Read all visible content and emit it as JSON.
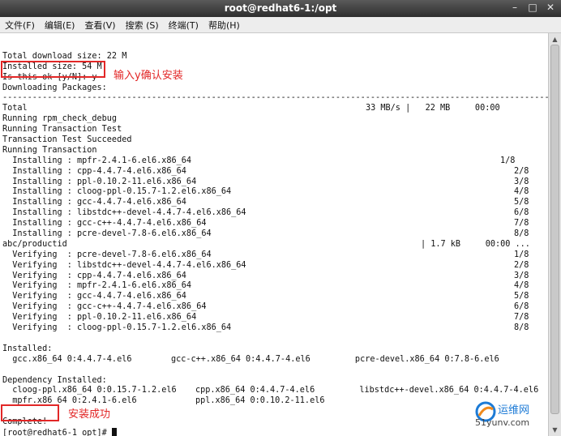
{
  "window": {
    "title": "root@redhat6-1:/opt",
    "buttons": [
      "–",
      "□",
      "✕"
    ]
  },
  "menu": [
    "文件(F)",
    "编辑(E)",
    "查看(V)",
    "搜索 (S)",
    "终端(T)",
    "帮助(H)"
  ],
  "terminal": {
    "lines": [
      {
        "t": ""
      },
      {
        "t": "Total download size: 22 M"
      },
      {
        "t": "Installed size: 54 M"
      },
      {
        "t": "Is this ok [y/N]: y"
      },
      {
        "t": "Downloading Packages:"
      },
      {
        "t": "--------------------------------------------------------------------------------------------------------------"
      },
      {
        "t": "Total",
        "c2": "33 MB/s |   22 MB     00:00",
        "c2x": 448
      },
      {
        "t": "Running rpm_check_debug"
      },
      {
        "t": "Running Transaction Test"
      },
      {
        "t": "Transaction Test Succeeded"
      },
      {
        "t": "Running Transaction"
      },
      {
        "t": "  Installing : mpfr-2.4.1-6.el6.x86_64",
        "c2": "1/8",
        "c2x": 614
      },
      {
        "t": "  Installing : cpp-4.4.7-4.el6.x86_64",
        "c2": "2/8",
        "c2x": 631
      },
      {
        "t": "  Installing : ppl-0.10.2-11.el6.x86_64",
        "c2": "3/8",
        "c2x": 631
      },
      {
        "t": "  Installing : cloog-ppl-0.15.7-1.2.el6.x86_64",
        "c2": "4/8",
        "c2x": 631
      },
      {
        "t": "  Installing : gcc-4.4.7-4.el6.x86_64",
        "c2": "5/8",
        "c2x": 631
      },
      {
        "t": "  Installing : libstdc++-devel-4.4.7-4.el6.x86_64",
        "c2": "6/8",
        "c2x": 631
      },
      {
        "t": "  Installing : gcc-c++-4.4.7-4.el6.x86_64",
        "c2": "7/8",
        "c2x": 631
      },
      {
        "t": "  Installing : pcre-devel-7.8-6.el6.x86_64",
        "c2": "8/8",
        "c2x": 631
      },
      {
        "t": "abc/productid",
        "c2": "| 1.7 kB     00:00 ...",
        "c2x": 516
      },
      {
        "t": "  Verifying  : pcre-devel-7.8-6.el6.x86_64",
        "c2": "1/8",
        "c2x": 631
      },
      {
        "t": "  Verifying  : libstdc++-devel-4.4.7-4.el6.x86_64",
        "c2": "2/8",
        "c2x": 631
      },
      {
        "t": "  Verifying  : cpp-4.4.7-4.el6.x86_64",
        "c2": "3/8",
        "c2x": 631
      },
      {
        "t": "  Verifying  : mpfr-2.4.1-6.el6.x86_64",
        "c2": "4/8",
        "c2x": 631
      },
      {
        "t": "  Verifying  : gcc-4.4.7-4.el6.x86_64",
        "c2": "5/8",
        "c2x": 631
      },
      {
        "t": "  Verifying  : gcc-c++-4.4.7-4.el6.x86_64",
        "c2": "6/8",
        "c2x": 631
      },
      {
        "t": "  Verifying  : ppl-0.10.2-11.el6.x86_64",
        "c2": "7/8",
        "c2x": 631
      },
      {
        "t": "  Verifying  : cloog-ppl-0.15.7-1.2.el6.x86_64",
        "c2": "8/8",
        "c2x": 631
      },
      {
        "t": ""
      },
      {
        "t": "Installed:"
      },
      {
        "t": "  gcc.x86_64 0:4.4.7-4.el6",
        "c2": "gcc-c++.x86_64 0:4.4.7-4.el6         pcre-devel.x86_64 0:7.8-6.el6",
        "c2x": 208
      },
      {
        "t": ""
      },
      {
        "t": "Dependency Installed:"
      },
      {
        "t": "  cloog-ppl.x86_64 0:0.15.7-1.2.el6",
        "c2": "cpp.x86_64 0:4.4.7-4.el6         libstdc++-devel.x86_64 0:4.4.7-4.el6",
        "c2x": 238
      },
      {
        "t": "  mpfr.x86_64 0:2.4.1-6.el6",
        "c2": "ppl.x86_64 0:0.10.2-11.el6",
        "c2x": 238
      },
      {
        "t": ""
      },
      {
        "t": "Complete!"
      },
      {
        "t": "[root@redhat6-1 opt]# "
      }
    ]
  },
  "annotations": {
    "confirm": "输入y确认安装",
    "success": "安装成功"
  },
  "watermark": {
    "name": "运维网",
    "domain": "51yunv.com"
  },
  "colors": {
    "annotation": "#e22727",
    "titlebar": "#3c3c3c"
  }
}
